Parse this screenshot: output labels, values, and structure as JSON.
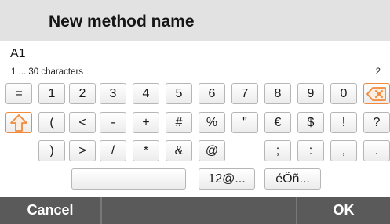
{
  "dialog": {
    "title": "New method name"
  },
  "input": {
    "value": "A1",
    "hint": "1 ... 30 characters",
    "count": "2"
  },
  "keyboard": {
    "row1": [
      "=",
      "1",
      "2",
      "3",
      "4",
      "5",
      "6",
      "7",
      "8",
      "9",
      "0"
    ],
    "row2": [
      "(",
      "<",
      "-",
      "+",
      "#",
      "%",
      "\"",
      "€",
      "$",
      "!",
      "?"
    ],
    "row3": [
      ")",
      ">",
      "/",
      "*",
      "&",
      "@",
      ";",
      ":",
      ",",
      "."
    ],
    "row4": {
      "space": "",
      "symbols": "12@...",
      "accents": "éÖñ..."
    }
  },
  "footer": {
    "cancel": "Cancel",
    "ok": "OK"
  },
  "colors": {
    "accent": "#f08a3c",
    "footer": "#5a5a5a",
    "header": "#e2e2e2"
  }
}
